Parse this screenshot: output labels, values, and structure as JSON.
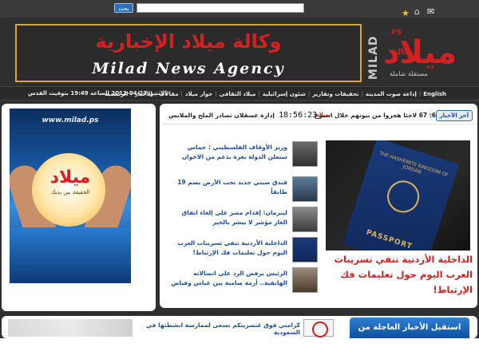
{
  "topbar": {
    "search_button": "بحث",
    "search_placeholder": ""
  },
  "banner": {
    "arabic_title": "وكالة ميلاد الإخبارية",
    "english_title": "Milad News Agency"
  },
  "logo": {
    "vertical_text": "MILAD",
    "ps": ".PS",
    "main": "ميلاد",
    "small": "وكالة",
    "sub": "مستقلة شاملة"
  },
  "nav": {
    "items": [
      "الرئيسية",
      "الأخبار",
      "مقالات",
      "حوار ميلاد",
      "ميلاد الثقافي",
      "شئون إسرائيلية",
      "تحقيقات وتقارير",
      "إذاعة صوت المدينة",
      "English"
    ],
    "date": "الإثنين 23-04-2012 الساعة 19:49 بتوقيت القدس"
  },
  "ad": {
    "url": "www.milad.ps",
    "logo": "ميلاد",
    "tagline": "الحقيقة بين يديك"
  },
  "ticker": {
    "badge": "آخر الأخبار",
    "text_right": "6: 67 لاجئا هجروا من بيوتهم خلال اسبوع",
    "logo": "ميلاد",
    "time": "18:56:23",
    "text_left": "إدارة عسقلان تصادر الملح والملابس والحر"
  },
  "feature": {
    "passport_line": "THE HASHEMITE KINGDOM OF JORDAN",
    "passport_word": "PASSPORT",
    "title": "الداخلية الأردنية تنفي تسريبات العرب اليوم حول تعليمات فك الإرتباط!"
  },
  "news": [
    {
      "text": "وزير الأوقاف الفلسطيني : حماس ستعلن الدولة بغزة بدعم من الاخوان"
    },
    {
      "text": "فندق صيني جديد تحت الأرض يضم 19 طابقاً"
    },
    {
      "text": "ليبرمان: إقدام مصر على إلغاء اتفاق الغاز مؤشر لا يبشر بالخير"
    },
    {
      "text": "الداخلية الأردنية تنفي تسريبات العرب اليوم حول تعليمات فك الإرتباط!"
    },
    {
      "text": "الرئيس يرفض الرد على اتصالاته الهاتفية.. أزمة صامتة بين عباس وفياض"
    }
  ],
  "bottom": {
    "text": "كرامتي فوق عنصريتكم تسعى لممارسة انشطتها في السعودية",
    "badge": "استقبل الأخبار العاجلة من"
  },
  "colors": {
    "brand_red": "#d42020",
    "link_blue": "#1a4f9a",
    "banner_border": "#d8a53c"
  }
}
